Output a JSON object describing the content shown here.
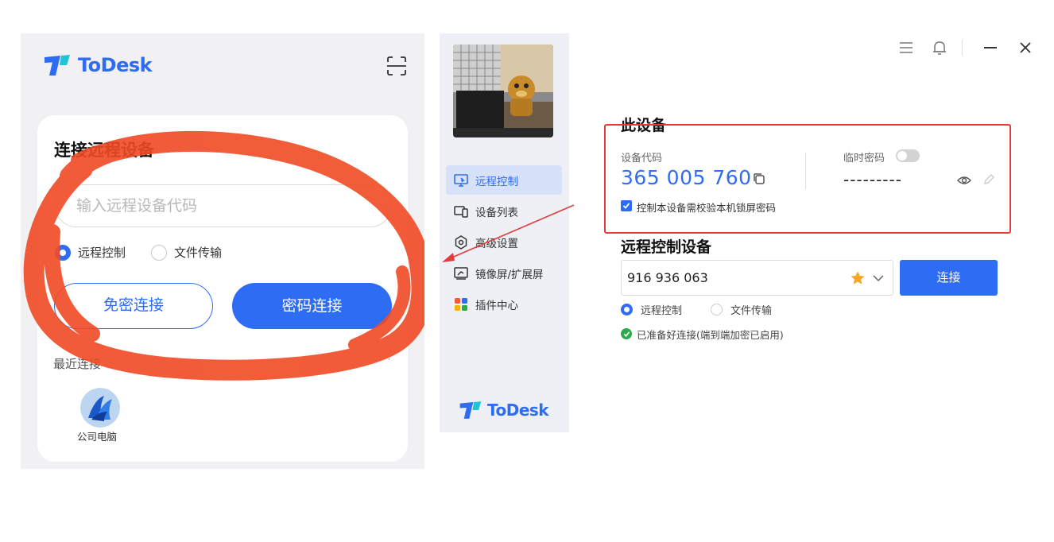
{
  "mobile": {
    "brand": "ToDesk",
    "card_title": "连接远程设备",
    "input_placeholder": "输入远程设备代码",
    "mode_options": [
      {
        "label": "远程控制",
        "selected": true
      },
      {
        "label": "文件传输",
        "selected": false
      }
    ],
    "btn_no_password": "免密连接",
    "btn_password": "密码连接",
    "recent_title": "最近连接",
    "more": "···",
    "recent_items": [
      {
        "label": "公司电脑"
      }
    ]
  },
  "sidebar": {
    "items": [
      {
        "label": "远程控制",
        "icon": "monitor-icon",
        "active": true
      },
      {
        "label": "设备列表",
        "icon": "devices-icon",
        "active": false
      },
      {
        "label": "高级设置",
        "icon": "gear-icon",
        "active": false
      },
      {
        "label": "镜像屏/扩展屏",
        "icon": "mirror-screen-icon",
        "active": false
      },
      {
        "label": "插件中心",
        "icon": "plugins-icon",
        "active": false
      }
    ],
    "brand": "ToDesk"
  },
  "desktop": {
    "this_device_title": "此设备",
    "device_code_label": "设备代码",
    "device_code": "365 005 760",
    "temp_password_label": "临时密码",
    "temp_password_enabled": false,
    "temp_password_value": "---------",
    "lock_checkbox_label": "控制本设备需校验本机锁屏密码",
    "lock_checkbox_checked": true,
    "remote_title": "远程控制设备",
    "remote_input_value": "916 936 063",
    "connect_label": "连接",
    "mode_options": [
      {
        "label": "远程控制",
        "selected": true
      },
      {
        "label": "文件传输",
        "selected": false
      }
    ],
    "status_text": "已准备好连接(端到端加密已启用)"
  },
  "colors": {
    "accent": "#2f6cf4",
    "annotation_red": "#e33b3b",
    "scribble": "#f04a24",
    "status_green": "#2dab4a"
  }
}
